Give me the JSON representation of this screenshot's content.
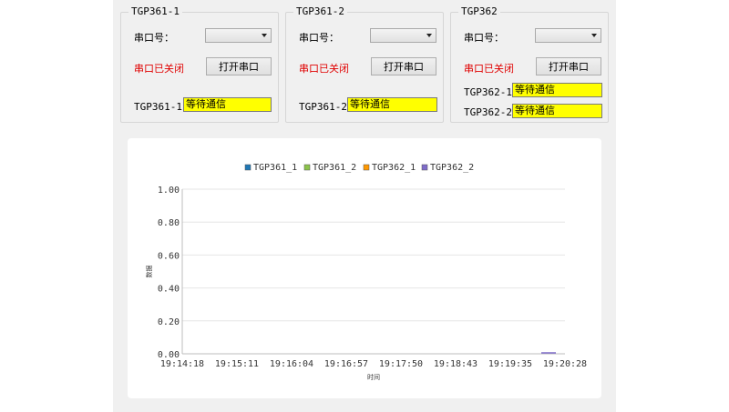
{
  "groups": [
    {
      "title": "TGP361-1",
      "port_label": "串口号：",
      "status": "串口已关闭",
      "button": "打开串口",
      "channels": [
        {
          "label": "TGP361-1",
          "value": "等待通信"
        }
      ]
    },
    {
      "title": "TGP361-2",
      "port_label": "串口号：",
      "status": "串口已关闭",
      "button": "打开串口",
      "channels": [
        {
          "label": "TGP361-2",
          "value": "等待通信"
        }
      ]
    },
    {
      "title": "TGP362",
      "port_label": "串口号：",
      "status": "串口已关闭",
      "button": "打开串口",
      "channels": [
        {
          "label": "TGP362-1",
          "value": "等待通信"
        },
        {
          "label": "TGP362-2",
          "value": "等待通信"
        }
      ]
    }
  ],
  "colors": {
    "status_closed": "#e00000",
    "value_box": "#ffff00"
  },
  "chart_data": {
    "type": "line",
    "xlabel": "时间",
    "ylabel": "数据",
    "ylim": [
      0,
      1
    ],
    "yticks": [
      "0.00",
      "0.20",
      "0.40",
      "0.60",
      "0.80",
      "1.00"
    ],
    "x_categories": [
      "19:14:18",
      "19:15:11",
      "19:16:04",
      "19:16:57",
      "19:17:50",
      "19:18:43",
      "19:19:35",
      "19:20:28"
    ],
    "legend_position": "top",
    "series": [
      {
        "name": "TGP361_1",
        "color": "#1f77b4",
        "values": []
      },
      {
        "name": "TGP361_2",
        "color": "#8bc34a",
        "values": []
      },
      {
        "name": "TGP362_1",
        "color": "#ff9800",
        "values": []
      },
      {
        "name": "TGP362_2",
        "color": "#7e6bc9",
        "values": []
      }
    ],
    "grid": true
  }
}
